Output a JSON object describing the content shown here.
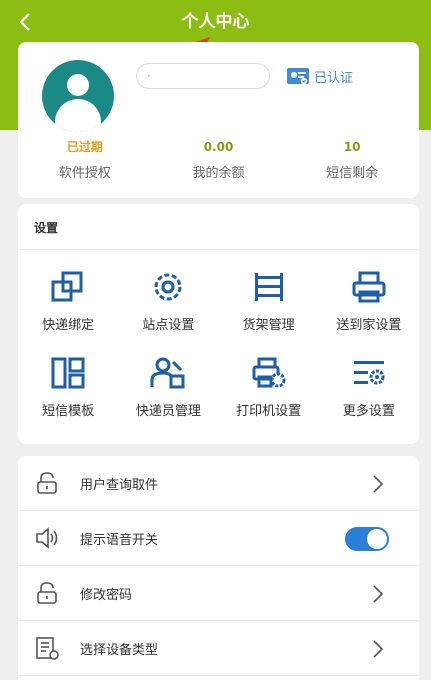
{
  "header": {
    "back_icon": "chevron-left-icon",
    "title": "个人中心"
  },
  "profile": {
    "name_placeholder": "·",
    "verified_label": "已认证",
    "stats": [
      {
        "value": "已过期",
        "label": "软件授权",
        "color": "#e89a1a"
      },
      {
        "value": "0.00",
        "label": "我的余额",
        "color": "#8a9a12"
      },
      {
        "value": "10",
        "label": "短信剩余",
        "color": "#8a9a12"
      }
    ]
  },
  "settings": {
    "title": "设置",
    "items": [
      {
        "label": "快递绑定",
        "icon": "bind-icon"
      },
      {
        "label": "站点设置",
        "icon": "gear-icon"
      },
      {
        "label": "货架管理",
        "icon": "shelf-icon"
      },
      {
        "label": "送到家设置",
        "icon": "printer-delivery-icon"
      },
      {
        "label": "短信模板",
        "icon": "template-icon"
      },
      {
        "label": "快递员管理",
        "icon": "courier-icon"
      },
      {
        "label": "打印机设置",
        "icon": "printer-gear-icon"
      },
      {
        "label": "更多设置",
        "icon": "more-settings-icon"
      }
    ]
  },
  "list": [
    {
      "label": "用户查询取件",
      "icon": "lock-icon",
      "action": "chevron"
    },
    {
      "label": "提示语音开关",
      "icon": "speaker-icon",
      "action": "toggle",
      "toggle_on": true
    },
    {
      "label": "修改密码",
      "icon": "lock-icon",
      "action": "chevron"
    },
    {
      "label": "选择设备类型",
      "icon": "device-list-icon",
      "action": "chevron"
    }
  ],
  "colors": {
    "header": "#8cbd13",
    "accent_blue": "#2a7fd6",
    "icon_blue": "#1d5ea8",
    "avatar": "#1b8a86"
  }
}
